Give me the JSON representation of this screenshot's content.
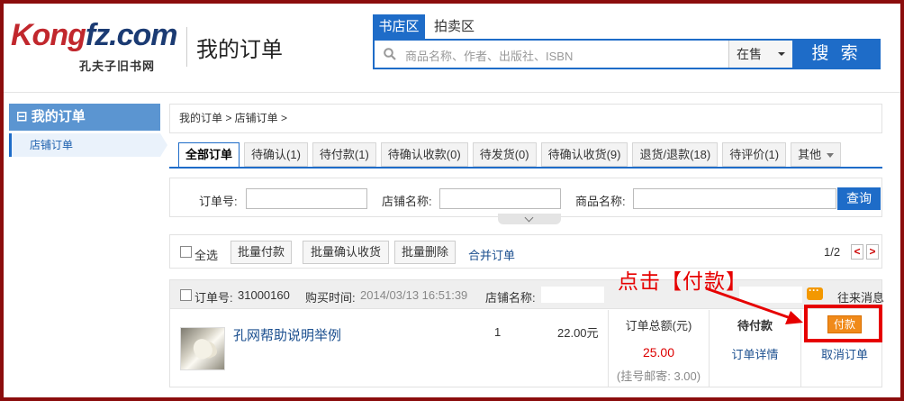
{
  "header": {
    "logo_main": "Kongfz.com",
    "logo_sub": "孔夫子旧书网",
    "page_title": "我的订单",
    "search_tabs": [
      "书店区",
      "拍卖区"
    ],
    "search_placeholder": "商品名称、作者、出版社、ISBN",
    "search_status": "在售",
    "search_button": "搜 索"
  },
  "sidebar": {
    "heading": "我的订单",
    "heading_glyph": "⊟",
    "items": [
      {
        "label": "店铺订单"
      }
    ]
  },
  "breadcrumb": {
    "text": "我的订单 > 店铺订单 >"
  },
  "tabs": [
    {
      "label": "全部订单"
    },
    {
      "label": "待确认(1)"
    },
    {
      "label": "待付款(1)"
    },
    {
      "label": "待确认收款(0)"
    },
    {
      "label": "待发货(0)"
    },
    {
      "label": "待确认收货(9)"
    },
    {
      "label": "退货/退款(18)"
    },
    {
      "label": "待评价(1)"
    },
    {
      "label": "其他"
    }
  ],
  "filter": {
    "order_no_label": "订单号:",
    "shop_name_label": "店铺名称:",
    "product_name_label": "商品名称:",
    "query_button": "查询"
  },
  "bulk": {
    "select_all": "全选",
    "batch_pay": "批量付款",
    "batch_confirm": "批量确认收货",
    "batch_delete": "批量删除",
    "merge": "合并订单",
    "page_indicator": "1/2",
    "prev": "<",
    "next": ">"
  },
  "order": {
    "order_no_label": "订单号:",
    "order_no": "31000160",
    "buy_time_label": "购买时间:",
    "buy_time": "2014/03/13 16:51:39",
    "shop_name_label": "店铺名称:",
    "message_link": "往来消息",
    "product_name": "孔网帮助说明举例",
    "quantity": "1",
    "unit_price": "22.00元",
    "total_label": "订单总额(元)",
    "total": "25.00",
    "shipping": "(挂号邮寄: 3.00)",
    "status": "待付款",
    "detail_link": "订单详情",
    "pay_button": "付款",
    "cancel_link": "取消订单"
  },
  "annotation": {
    "text": "点击【付款】",
    "color": "#e60000"
  },
  "colors": {
    "brand_blue": "#1e6cc8",
    "logo_red": "#c1272d",
    "pay_orange": "#f08a1a",
    "frame": "#8b0d0d"
  }
}
